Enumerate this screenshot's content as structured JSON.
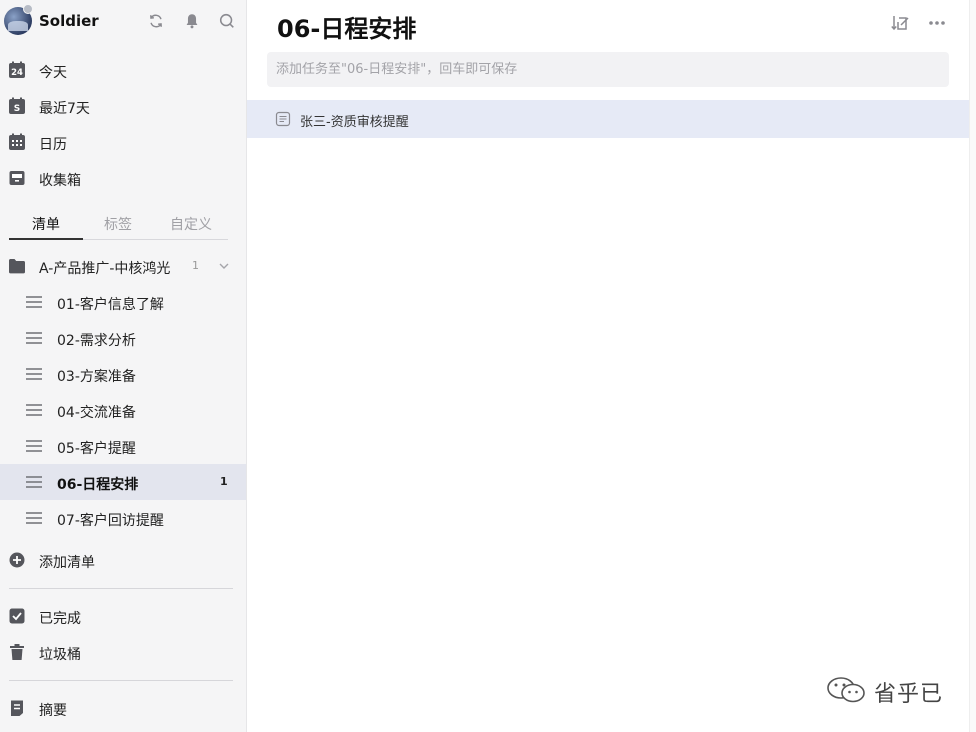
{
  "account": {
    "name": "Soldier"
  },
  "smart_lists": [
    {
      "label": "今天",
      "icon": "calendar-today-icon",
      "badge": "24"
    },
    {
      "label": "最近7天",
      "icon": "calendar-week-icon",
      "badge": "S"
    },
    {
      "label": "日历",
      "icon": "calendar-grid-icon"
    },
    {
      "label": "收集箱",
      "icon": "inbox-icon"
    }
  ],
  "tabs": [
    {
      "label": "清单",
      "active": true
    },
    {
      "label": "标签",
      "active": false
    },
    {
      "label": "自定义",
      "active": false
    }
  ],
  "folder": {
    "label": "A-产品推广-中核鸿光",
    "count": "1"
  },
  "lists": [
    {
      "label": "01-客户信息了解"
    },
    {
      "label": "02-需求分析"
    },
    {
      "label": "03-方案准备"
    },
    {
      "label": "04-交流准备"
    },
    {
      "label": "05-客户提醒"
    },
    {
      "label": "06-日程安排",
      "count": "1",
      "selected": true
    },
    {
      "label": "07-客户回访提醒"
    }
  ],
  "add_list_label": "添加清单",
  "bottom_items": [
    {
      "label": "已完成",
      "icon": "checkbox-checked-icon"
    },
    {
      "label": "垃圾桶",
      "icon": "trash-icon"
    }
  ],
  "summary_label": "摘要",
  "main": {
    "title": "06-日程安排",
    "add_task_placeholder": "添加任务至\"06-日程安排\"，回车即可保存",
    "tasks": [
      {
        "label": "张三-资质审核提醒"
      }
    ]
  },
  "watermark": {
    "text": "省乎已"
  },
  "colors": {
    "sidebar_bg": "#f5f5f6",
    "selected_bg": "#e3e5ee",
    "task_selected_bg": "#e6eaf6"
  }
}
